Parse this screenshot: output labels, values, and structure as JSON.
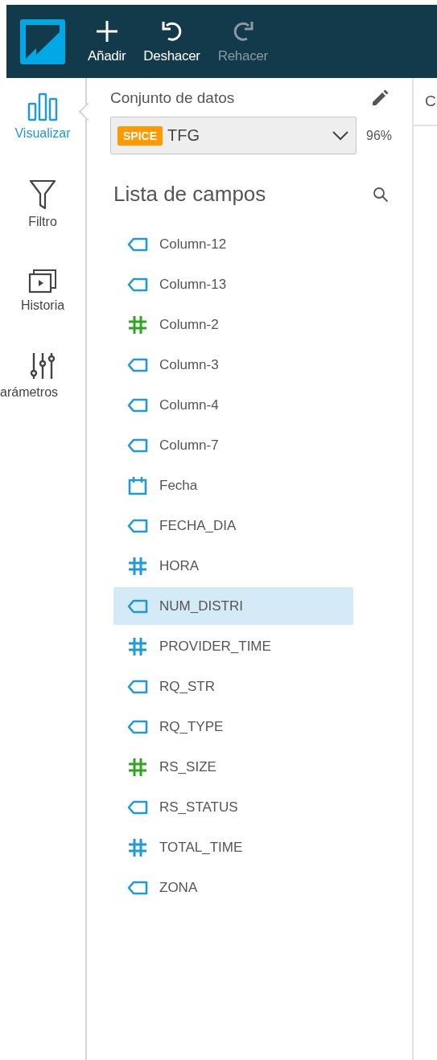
{
  "toolbar": {
    "buttons": [
      {
        "label": "Añadir",
        "kind": "add",
        "disabled": false
      },
      {
        "label": "Deshacer",
        "kind": "undo",
        "disabled": false
      },
      {
        "label": "Rehacer",
        "kind": "redo",
        "disabled": true
      }
    ]
  },
  "nav": [
    {
      "label": "Visualizar",
      "kind": "visualize",
      "selected": true
    },
    {
      "label": "Filtro",
      "kind": "filter",
      "selected": false
    },
    {
      "label": "Historia",
      "kind": "story",
      "selected": false
    },
    {
      "label": "arámetros",
      "kind": "parameters",
      "selected": false
    }
  ],
  "dataset": {
    "title": "Conjunto de datos",
    "badge": "SPICE",
    "name": "TFG",
    "usage": "96%"
  },
  "fields": {
    "title": "Lista de campos",
    "items": [
      {
        "label": "Column-12",
        "kind": "text",
        "selected": false
      },
      {
        "label": "Column-13",
        "kind": "text",
        "selected": false
      },
      {
        "label": "Column-2",
        "kind": "number",
        "color": "#2ea421",
        "selected": false
      },
      {
        "label": "Column-3",
        "kind": "text",
        "selected": false
      },
      {
        "label": "Column-4",
        "kind": "text",
        "selected": false
      },
      {
        "label": "Column-7",
        "kind": "text",
        "selected": false
      },
      {
        "label": "Fecha",
        "kind": "date",
        "selected": false
      },
      {
        "label": "FECHA_DIA",
        "kind": "text",
        "selected": false
      },
      {
        "label": "HORA",
        "kind": "number",
        "color": "#1f9ad6",
        "selected": false
      },
      {
        "label": "NUM_DISTRI",
        "kind": "text",
        "selected": true
      },
      {
        "label": "PROVIDER_TIME",
        "kind": "number",
        "color": "#1f9ad6",
        "selected": false
      },
      {
        "label": "RQ_STR",
        "kind": "text",
        "selected": false
      },
      {
        "label": "RQ_TYPE",
        "kind": "text",
        "selected": false
      },
      {
        "label": "RS_SIZE",
        "kind": "number",
        "color": "#2ea421",
        "selected": false
      },
      {
        "label": "RS_STATUS",
        "kind": "text",
        "selected": false
      },
      {
        "label": "TOTAL_TIME",
        "kind": "number",
        "color": "#1f9ad6",
        "selected": false
      },
      {
        "label": "ZONA",
        "kind": "text",
        "selected": false
      }
    ]
  },
  "canvas": {
    "tab_label": "C"
  }
}
